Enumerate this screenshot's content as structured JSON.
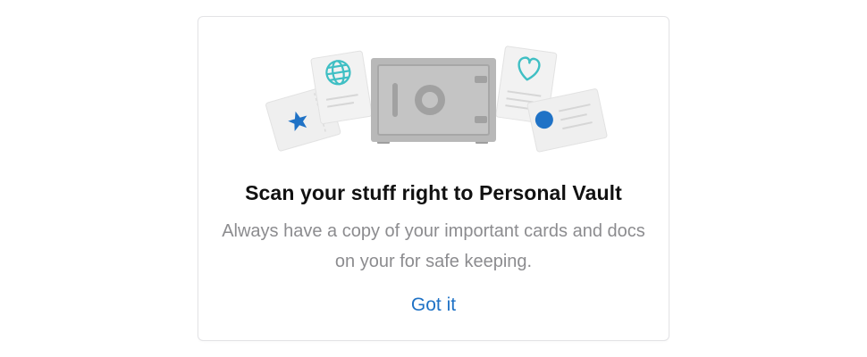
{
  "dialog": {
    "title": "Scan your stuff right to Personal Vault",
    "description": "Always have a copy of your important cards and docs on your for safe keeping.",
    "action_label": "Got it"
  },
  "colors": {
    "accent": "#1f72c6",
    "teal": "#3fbfc4",
    "safe_gray": "#b3b3b3",
    "card_gray": "#f0f0f0"
  },
  "illustration": {
    "icons": [
      "star-icon",
      "globe-icon",
      "safe-icon",
      "heart-icon",
      "dot-icon"
    ]
  }
}
